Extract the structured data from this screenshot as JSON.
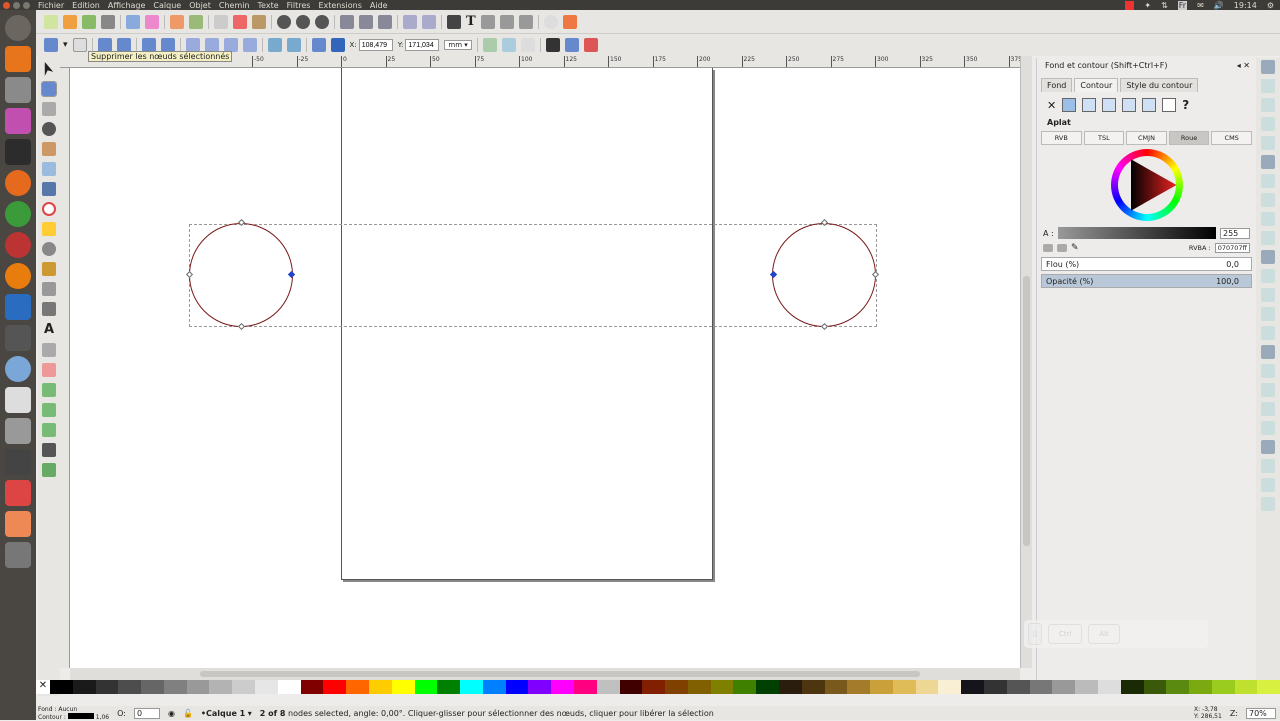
{
  "menubar": {
    "items": [
      "Fichier",
      "Edition",
      "Affichage",
      "Calque",
      "Objet",
      "Chemin",
      "Texte",
      "Filtres",
      "Extensions",
      "Aide"
    ],
    "tray": {
      "lang": "Fr",
      "time": "19:14"
    }
  },
  "node_toolbar": {
    "x_label": "X:",
    "x_value": "108,479",
    "y_label": "Y:",
    "y_value": "171,034",
    "unit": "mm"
  },
  "tooltip": "Supprimer les nœuds sélectionnés",
  "ruler": {
    "labels": [
      "-50",
      "-25",
      "0",
      "25",
      "50",
      "75",
      "100",
      "125",
      "150",
      "175",
      "200",
      "225",
      "250",
      "275",
      "300",
      "325",
      "350",
      "375"
    ]
  },
  "panel": {
    "title": "Fond et contour (Shift+Ctrl+F)",
    "tabs": [
      "Fond",
      "Contour",
      "Style du contour"
    ],
    "paint_label": "Aplat",
    "modes": [
      "RVB",
      "TSL",
      "CMJN",
      "Roue",
      "CMS"
    ],
    "active_mode": "Roue",
    "alpha_label": "A :",
    "alpha_value": "255",
    "rgba_label": "RVBA :",
    "rgba_value": "070707ff",
    "blur_label": "Flou (%)",
    "blur_value": "0,0",
    "opacity_label": "Opacité (%)",
    "opacity_value": "100,0"
  },
  "palette": [
    "#000000",
    "#1a1a1a",
    "#333",
    "#4d4d4d",
    "#666",
    "#808080",
    "#999",
    "#b3b3b3",
    "#ccc",
    "#e6e6e6",
    "#fff",
    "#800000",
    "#ff0000",
    "#ff6600",
    "#ffcc00",
    "#ffff00",
    "#00ff00",
    "#008000",
    "#00ffff",
    "#0080ff",
    "#0000ff",
    "#8000ff",
    "#ff00ff",
    "#ff0080",
    "#c0c0c0",
    "#400000",
    "#802000",
    "#804000",
    "#806000",
    "#808000",
    "#408000",
    "#004000",
    "#2b1d0e",
    "#4d3510",
    "#7a5a1c",
    "#a47b2a",
    "#c9a03a",
    "#dfbc58",
    "#eed694",
    "#f8efd4",
    "#15141a",
    "#333",
    "#555",
    "#777",
    "#999",
    "#bbb",
    "#ddd",
    "#1a2a05",
    "#3a5a0a",
    "#5a8a10",
    "#7aaa10",
    "#9acc20",
    "#c0e030",
    "#d8f040"
  ],
  "status": {
    "fill_label": "Fond :",
    "fill_value": "Aucun",
    "stroke_label": "Contour :",
    "stroke_width": "1,06",
    "opacity_label": "O:",
    "opacity_value": "0",
    "layer": "•Calque 1",
    "message_bold": "2 of 8",
    "message": " nodes selected, angle: 0,00°. Cliquer-glisser pour sélectionner des nœuds, cliquer pour libérer la sélection",
    "cursor_x_label": "X:",
    "cursor_x": "-3,78",
    "cursor_y_label": "Y:",
    "cursor_y": "286,51",
    "zoom_label": "Z:",
    "zoom": "70%"
  },
  "keys": [
    "Ctrl",
    "Alt"
  ]
}
